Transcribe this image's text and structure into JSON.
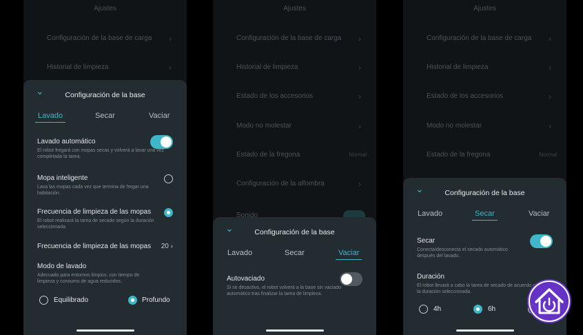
{
  "background": {
    "title": "Ajustes",
    "items": [
      "Configuración de la base de carga",
      "Historial de limpieza",
      "Estado de los accesorios",
      "Modo no molestar",
      "Estado de la fregona",
      "Configuración de la alfombra",
      "Sonido"
    ],
    "fregona_value": "Normal"
  },
  "sheet": {
    "title": "Configuración de la base",
    "tabs": [
      "Lavado",
      "Secar",
      "Vaciar"
    ]
  },
  "panel1": {
    "auto_wash": {
      "label": "Lavado automático",
      "desc": "El robot fregará con mopas secas y volverá a lavar una vez completada la tarea.",
      "on": true
    },
    "smart_mop": {
      "label": "Mopa inteligente",
      "desc": "Lava las mopas cada vez que termina de fregar una habitación.",
      "selected": false
    },
    "freq_mop": {
      "label": "Frecuencia de limpieza de las mopas",
      "desc": "El robot realizará la tarea de secado según la duración seleccionada.",
      "selected": true
    },
    "freq_value_row": {
      "label": "Frecuencia de limpieza de las mopas",
      "value": "20"
    },
    "wash_mode": {
      "label": "Modo de lavado",
      "desc": "Adecuado para entornos limpios, con tiempo de limpieza y consumo de agua reducidos.",
      "options": [
        "Equilibrado",
        "Profundo"
      ],
      "selected": "Profundo"
    }
  },
  "panel2": {
    "auto_empty": {
      "label": "Autovaciado",
      "desc": "Si se desactiva, el robot volverá a la base sin vaciado automático tras finalizar la tarea de limpieza.",
      "on": false
    }
  },
  "panel3": {
    "dry": {
      "label": "Secar",
      "desc": "Conecta/desconecta el secado automático después del lavado.",
      "on": true
    },
    "duration": {
      "label": "Duración",
      "desc": "El robot llevará a cabo la tarea de secado de acuerdo con la duración seleccionada.",
      "options": [
        "4h",
        "6h",
        "8h"
      ],
      "selected": "6h"
    }
  },
  "colors": {
    "accent": "#3fb6c9",
    "sheet_bg": "#232c31",
    "screen_bg": "#101417",
    "logo_purple": "#7b3fe4"
  }
}
